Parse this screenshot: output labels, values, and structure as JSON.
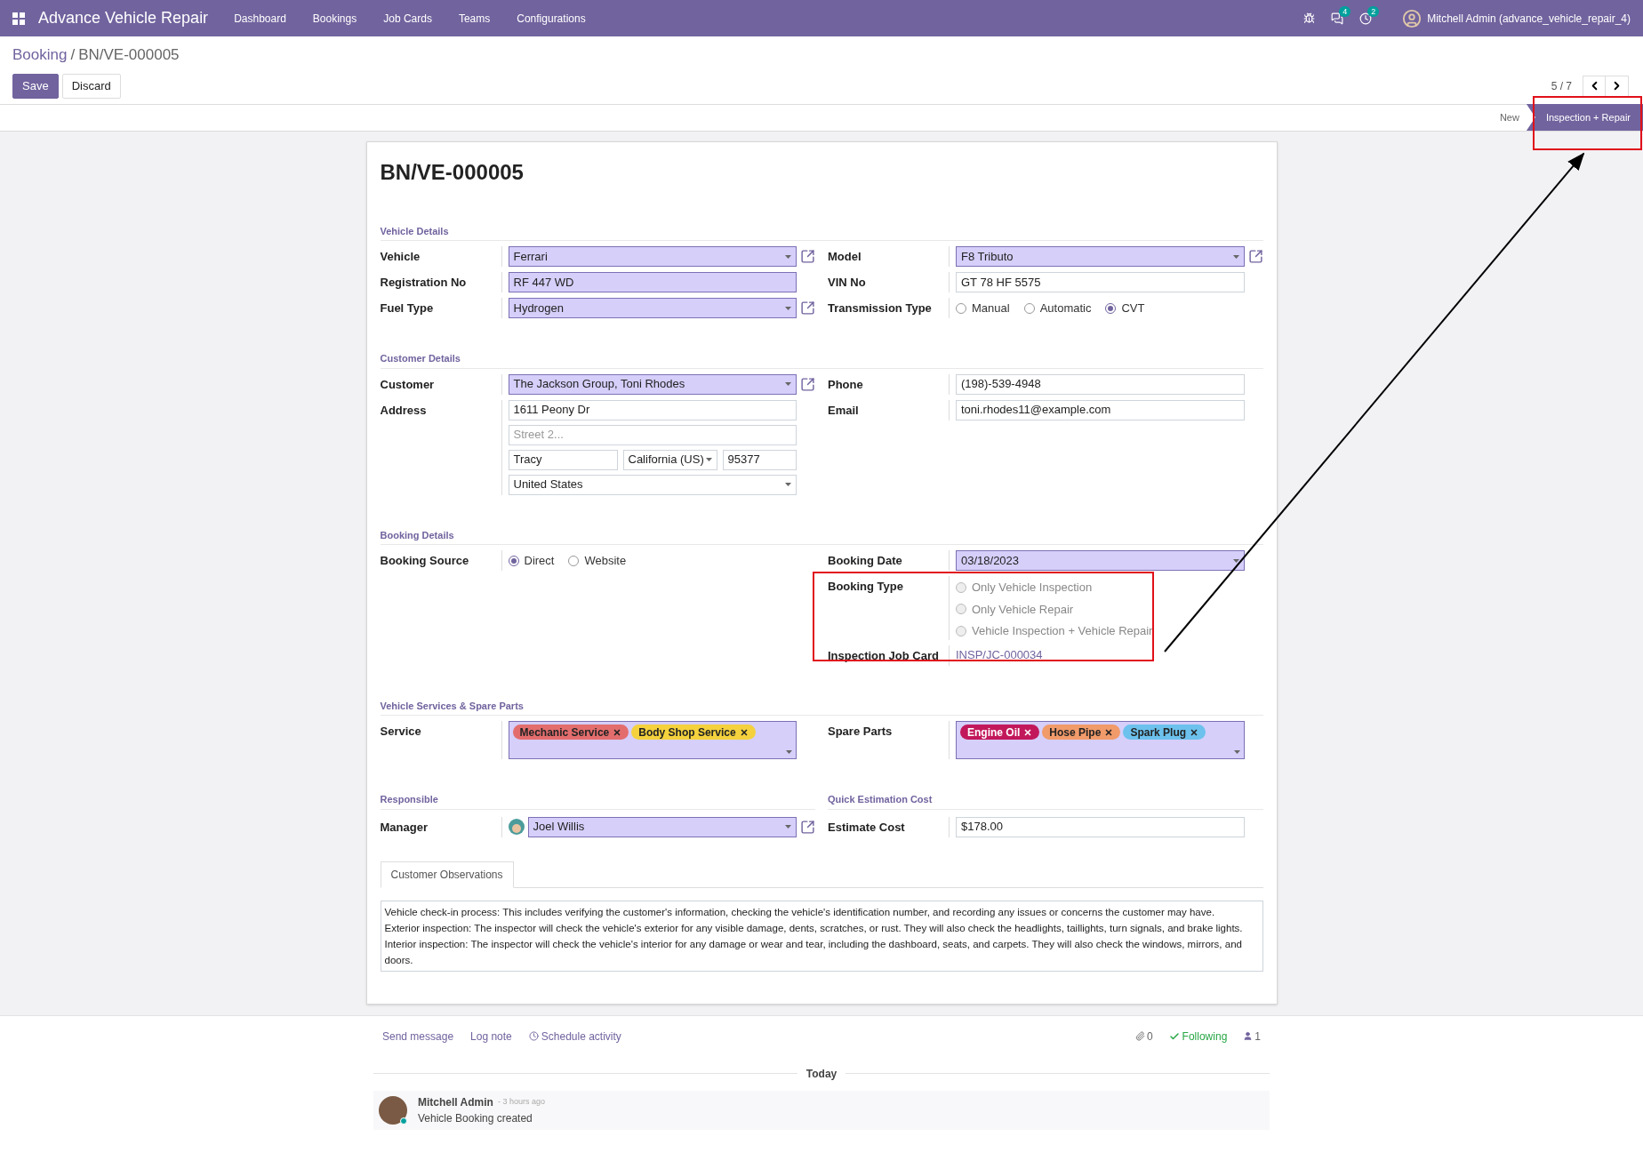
{
  "navbar": {
    "app_name": "Advance Vehicle Repair",
    "menu": [
      "Dashboard",
      "Bookings",
      "Job Cards",
      "Teams",
      "Configurations"
    ],
    "messages_count": "4",
    "activities_count": "2",
    "user": "Mitchell Admin (advance_vehicle_repair_4)"
  },
  "breadcrumb": {
    "parent": "Booking",
    "separator": "/",
    "current": "BN/VE-000005"
  },
  "buttons": [
    {
      "label": "Save",
      "kind": "primary"
    },
    {
      "label": "Discard",
      "kind": "secondary"
    }
  ],
  "pager": "5 / 7",
  "stages": [
    {
      "label": "New",
      "selected": false
    },
    {
      "label": "Inspection + Repair",
      "selected": true
    }
  ],
  "form": {
    "title": "BN/VE-000005",
    "sections": [
      {
        "heading": "Vehicle Details",
        "columns": [
          {
            "fields": [
              {
                "kind": "many2one",
                "label": "Vehicle",
                "value": "Ferrari",
                "required": true
              },
              {
                "kind": "char",
                "label": "Registration No",
                "value": "RF 447 WD",
                "required": true
              },
              {
                "kind": "many2one",
                "label": "Fuel Type",
                "value": "Hydrogen",
                "required": true
              }
            ]
          },
          {
            "fields": [
              {
                "kind": "many2one",
                "label": "Model",
                "value": "F8 Tributo",
                "required": true
              },
              {
                "kind": "char",
                "label": "VIN No",
                "value": "GT 78 HF 5575",
                "required": false
              },
              {
                "kind": "radio",
                "label": "Transmission Type",
                "readonly": false,
                "options": [
                  {
                    "label": "Manual",
                    "selected": false
                  },
                  {
                    "label": "Automatic",
                    "selected": false
                  },
                  {
                    "label": "CVT",
                    "selected": true
                  }
                ]
              }
            ]
          }
        ]
      },
      {
        "heading": "Customer Details",
        "columns": [
          {
            "fields": [
              {
                "kind": "many2one",
                "label": "Customer",
                "value": "The Jackson Group, Toni Rhodes",
                "required": true
              },
              {
                "kind": "address",
                "label": "Address",
                "street": "1611 Peony Dr",
                "street2_placeholder": "Street 2...",
                "city": "Tracy",
                "state": "California (US)",
                "zip": "95377",
                "country": "United States"
              }
            ]
          },
          {
            "fields": [
              {
                "kind": "char",
                "label": "Phone",
                "value": "(198)-539-4948",
                "required": false
              },
              {
                "kind": "char",
                "label": "Email",
                "value": "toni.rhodes11@example.com",
                "required": false
              }
            ]
          }
        ]
      },
      {
        "heading": "Booking Details",
        "columns": [
          {
            "fields": [
              {
                "kind": "radio",
                "label": "Booking Source",
                "readonly": false,
                "options": [
                  {
                    "label": "Direct",
                    "selected": true
                  },
                  {
                    "label": "Website",
                    "selected": false
                  }
                ]
              }
            ]
          },
          {
            "fields": [
              {
                "kind": "date",
                "label": "Booking Date",
                "value": "03/18/2023",
                "required": true
              },
              {
                "kind": "radio",
                "label": "Booking Type",
                "readonly": true,
                "vertical": true,
                "options": [
                  {
                    "label": "Only Vehicle Inspection",
                    "selected": false
                  },
                  {
                    "label": "Only Vehicle Repair",
                    "selected": false
                  },
                  {
                    "label": "Vehicle Inspection + Vehicle Repair",
                    "selected": false
                  }
                ]
              },
              {
                "kind": "link",
                "label": "Inspection Job Card",
                "value": "INSP/JC-000034"
              }
            ]
          }
        ]
      },
      {
        "heading": "Vehicle Services & Spare Parts",
        "columns": [
          {
            "fields": [
              {
                "kind": "tags",
                "label": "Service",
                "required": true,
                "tags": [
                  {
                    "label": "Mechanic Service",
                    "color": "#e36d6d"
                  },
                  {
                    "label": "Body Shop Service",
                    "color": "#f4d13d"
                  }
                ]
              }
            ]
          },
          {
            "fields": [
              {
                "kind": "tags",
                "label": "Spare Parts",
                "required": true,
                "tags": [
                  {
                    "label": "Engine Oil",
                    "color": "#c2185b"
                  },
                  {
                    "label": "Hose Pipe",
                    "color": "#f19a6a"
                  },
                  {
                    "label": "Spark Plug",
                    "color": "#6cc1ed"
                  }
                ]
              }
            ]
          }
        ]
      },
      {
        "columns": [
          {
            "heading": "Responsible",
            "fields": [
              {
                "kind": "many2one",
                "label": "Manager",
                "value": "Joel Willis",
                "required": true,
                "avatar": true
              }
            ]
          },
          {
            "heading": "Quick Estimation Cost",
            "fields": [
              {
                "kind": "char",
                "label": "Estimate Cost",
                "value": "$178.00",
                "required": false
              }
            ]
          }
        ]
      }
    ]
  },
  "notebook": {
    "tabs": [
      {
        "label": "Customer Observations",
        "selected": true
      }
    ],
    "text": "Vehicle check-in process: This includes verifying the customer's information, checking the vehicle's identification number, and recording any issues or concerns the customer may have.\nExterior inspection: The inspector will check the vehicle's exterior for any visible damage, dents, scratches, or rust. They will also check the headlights, taillights, turn signals, and brake lights.\nInterior inspection: The inspector will check the vehicle's interior for any damage or wear and tear, including the dashboard, seats, and carpets. They will also check the windows, mirrors, and doors."
  },
  "chatter": {
    "actions": [
      {
        "label": "Send message",
        "icon": false
      },
      {
        "label": "Log note",
        "icon": false
      },
      {
        "label": "Schedule activity",
        "icon": true
      }
    ],
    "attachments": "0",
    "follow": "Following",
    "followers": "1",
    "date_divider": "Today",
    "messages": [
      {
        "author": "Mitchell Admin",
        "time": "- 3 hours ago",
        "body": "Vehicle Booking created"
      }
    ]
  }
}
